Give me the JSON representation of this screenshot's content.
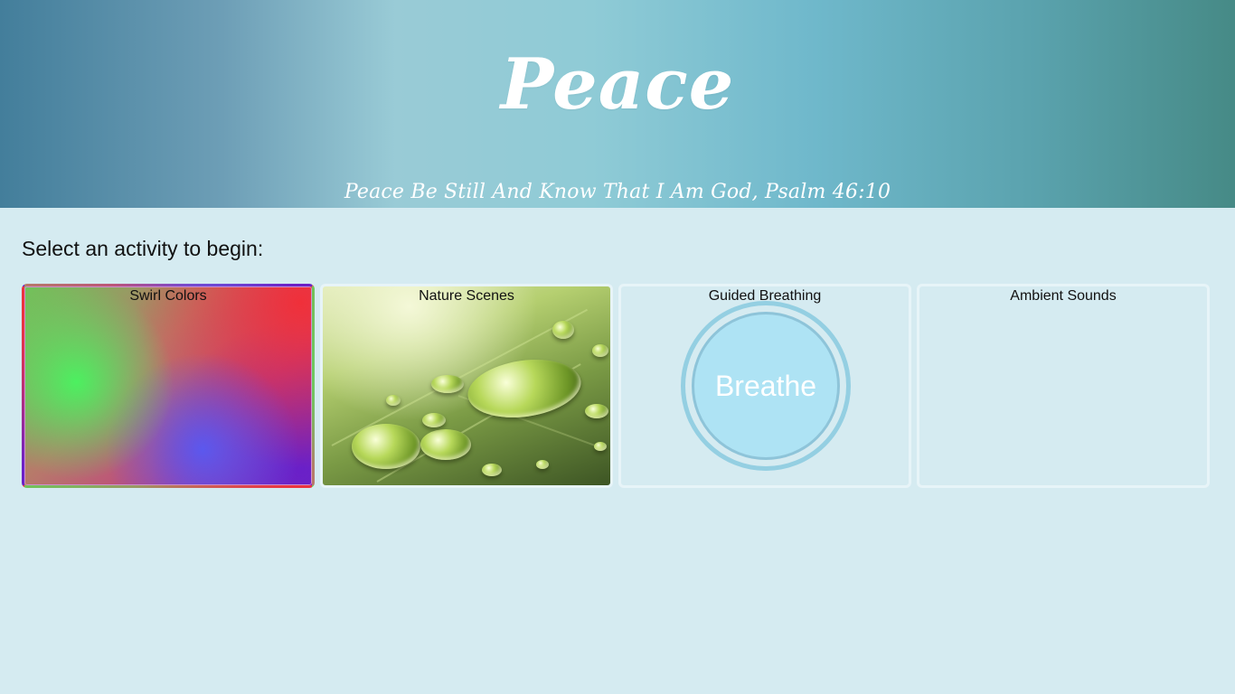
{
  "header": {
    "title": "Peace",
    "verse": "Peace Be Still And Know That I Am God, Psalm 46:10"
  },
  "main": {
    "prompt": "Select an activity to begin:",
    "activities": [
      {
        "label": "Swirl Colors"
      },
      {
        "label": "Nature Scenes"
      },
      {
        "label": "Guided Breathing",
        "button_text": "Breathe"
      },
      {
        "label": "Ambient Sounds"
      }
    ]
  },
  "colors": {
    "background": "#d5ebf1",
    "breathe_circle": "#aee3f4",
    "breathe_ring": "#94cfe2"
  },
  "icons": [
    "water-droplet-leaf-image",
    "color-swirl-gradient"
  ]
}
